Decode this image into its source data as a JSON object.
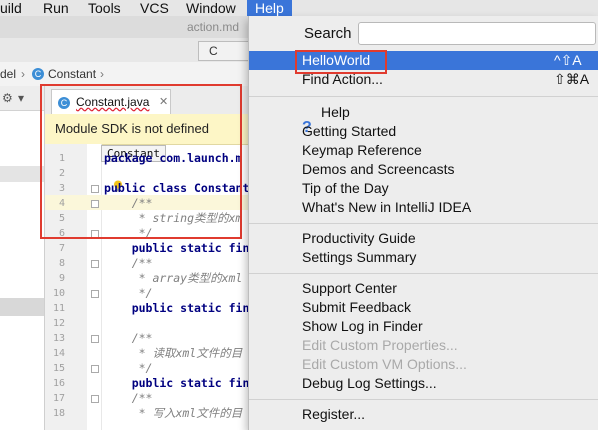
{
  "menubar": {
    "items": [
      "uild",
      "Run",
      "Tools",
      "VCS",
      "Window",
      "Help"
    ]
  },
  "ide": {
    "window_title": "action.md",
    "top_tab_label": "C",
    "breadcrumb": [
      "del",
      "Constant"
    ],
    "file_tab": "Constant.java",
    "sdk_banner": "Module SDK is not defined",
    "class_hint": "Constant",
    "code_lines": [
      {
        "n": "1",
        "text": "package com.launch.m"
      },
      {
        "n": "2",
        "text": ""
      },
      {
        "n": "3",
        "text": "public class Constant"
      },
      {
        "n": "4",
        "text": "    /**"
      },
      {
        "n": "5",
        "text": "     * string类型的xm"
      },
      {
        "n": "6",
        "text": "     */"
      },
      {
        "n": "7",
        "text": "    public static fin"
      },
      {
        "n": "8",
        "text": "    /**"
      },
      {
        "n": "9",
        "text": "     * array类型的xml"
      },
      {
        "n": "10",
        "text": "     */"
      },
      {
        "n": "11",
        "text": "    public static fin"
      },
      {
        "n": "12",
        "text": ""
      },
      {
        "n": "13",
        "text": "    /**"
      },
      {
        "n": "14",
        "text": "     * 读取xml文件的目"
      },
      {
        "n": "15",
        "text": "     */"
      },
      {
        "n": "16",
        "text": "    public static fin"
      },
      {
        "n": "17",
        "text": "    /**"
      },
      {
        "n": "18",
        "text": "     * 写入xml文件的目"
      }
    ]
  },
  "help_menu": {
    "search_label": "Search",
    "search_value": "",
    "items": {
      "helloworld": "HelloWorld",
      "helloworld_shortcut": "^⇧A",
      "find_action": "Find Action...",
      "find_action_shortcut": "⇧⌘A",
      "help": "Help",
      "getting_started": "Getting Started",
      "keymap_reference": "Keymap Reference",
      "demos": "Demos and Screencasts",
      "tip": "Tip of the Day",
      "whats_new": "What's New in IntelliJ IDEA",
      "productivity": "Productivity Guide",
      "settings_summary": "Settings Summary",
      "support_center": "Support Center",
      "submit_feedback": "Submit Feedback",
      "show_log": "Show Log in Finder",
      "edit_props": "Edit Custom Properties...",
      "edit_vm": "Edit Custom VM Options...",
      "debug_log": "Debug Log Settings...",
      "register": "Register..."
    },
    "colors": {
      "selection": "#3a75d9",
      "highlight_box": "#e03b2f"
    }
  }
}
